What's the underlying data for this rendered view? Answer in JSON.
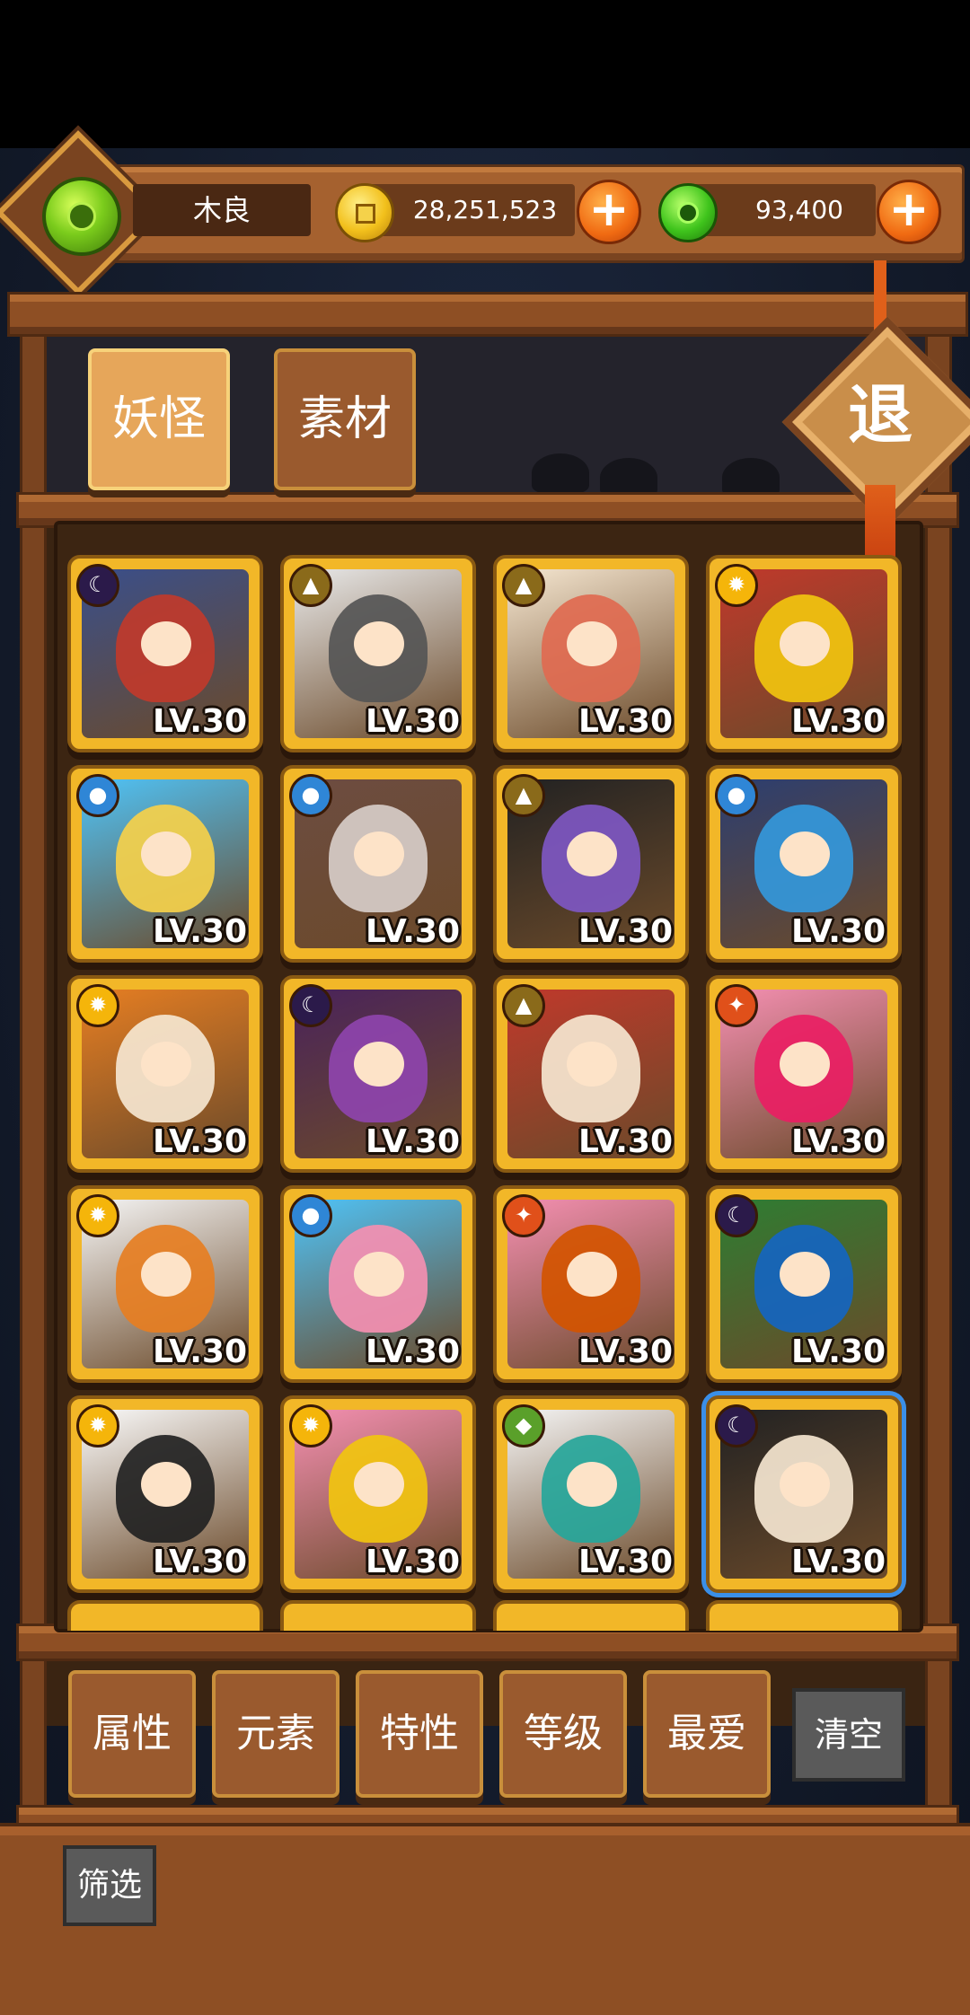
{
  "player": {
    "name": "木良"
  },
  "currency": {
    "gold": {
      "icon": "gold-coin-icon",
      "amount": "28,251,523"
    },
    "jade": {
      "icon": "jade-coin-icon",
      "amount": "93,400"
    }
  },
  "tabs": [
    {
      "label": "妖怪",
      "active": true
    },
    {
      "label": "素材",
      "active": false
    }
  ],
  "exit_label": "退",
  "monsters": [
    {
      "element": "moon",
      "level": "LV.30",
      "colors": [
        "#3a4f8a",
        "#c0392b"
      ]
    },
    {
      "element": "earth",
      "level": "LV.30",
      "colors": [
        "#e8e8e8",
        "#555555"
      ]
    },
    {
      "element": "earth",
      "level": "LV.30",
      "colors": [
        "#f5e6d0",
        "#e06a50"
      ]
    },
    {
      "element": "sun",
      "level": "LV.30",
      "colors": [
        "#c0392b",
        "#f1c40f"
      ]
    },
    {
      "element": "water",
      "level": "LV.30",
      "colors": [
        "#4fc3f7",
        "#f5d04a"
      ]
    },
    {
      "element": "water",
      "level": "LV.30",
      "colors": [
        "#6d4c41",
        "#d7ccc8"
      ]
    },
    {
      "element": "earth",
      "level": "LV.30",
      "colors": [
        "#222222",
        "#7e57c2"
      ]
    },
    {
      "element": "water",
      "level": "LV.30",
      "colors": [
        "#2c3e70",
        "#3498db"
      ]
    },
    {
      "element": "sun",
      "level": "LV.30",
      "colors": [
        "#e67e22",
        "#f5e6d0"
      ]
    },
    {
      "element": "moon",
      "level": "LV.30",
      "colors": [
        "#4a235a",
        "#8e44ad"
      ]
    },
    {
      "element": "earth",
      "level": "LV.30",
      "colors": [
        "#c0392b",
        "#f5e6d0"
      ]
    },
    {
      "element": "fire",
      "level": "LV.30",
      "colors": [
        "#f48fb1",
        "#e91e63"
      ]
    },
    {
      "element": "sun",
      "level": "LV.30",
      "colors": [
        "#f5f5f5",
        "#e67e22"
      ]
    },
    {
      "element": "water",
      "level": "LV.30",
      "colors": [
        "#4fc3f7",
        "#f48fb1"
      ]
    },
    {
      "element": "fire",
      "level": "LV.30",
      "colors": [
        "#f48fb1",
        "#d35400"
      ]
    },
    {
      "element": "moon",
      "level": "LV.30",
      "colors": [
        "#2e7d32",
        "#1565c0"
      ]
    },
    {
      "element": "sun",
      "level": "LV.30",
      "colors": [
        "#fafafa",
        "#222222"
      ]
    },
    {
      "element": "sun",
      "level": "LV.30",
      "colors": [
        "#f48fb1",
        "#f1c40f"
      ]
    },
    {
      "element": "leaf",
      "level": "LV.30",
      "colors": [
        "#f5f5f5",
        "#26a69a"
      ]
    },
    {
      "element": "moon",
      "level": "LV.30",
      "colors": [
        "#222222",
        "#f5e6d0"
      ],
      "selected": true
    }
  ],
  "element_icons": {
    "moon": {
      "icon": "moon-icon",
      "color": "#2b1a4a",
      "glyph": "☾"
    },
    "earth": {
      "icon": "earth-icon",
      "color": "#8a6a1a",
      "glyph": "▲"
    },
    "sun": {
      "icon": "sun-icon",
      "color": "#f5b50a",
      "glyph": "✹"
    },
    "water": {
      "icon": "water-icon",
      "color": "#2f86d6",
      "glyph": "●"
    },
    "fire": {
      "icon": "fire-icon",
      "color": "#e0501a",
      "glyph": "✦"
    },
    "leaf": {
      "icon": "leaf-icon",
      "color": "#5aa02a",
      "glyph": "◆"
    }
  },
  "filters": [
    "属性",
    "元素",
    "特性",
    "等级",
    "最爱"
  ],
  "clear_label": "清空",
  "sift_label": "筛选"
}
